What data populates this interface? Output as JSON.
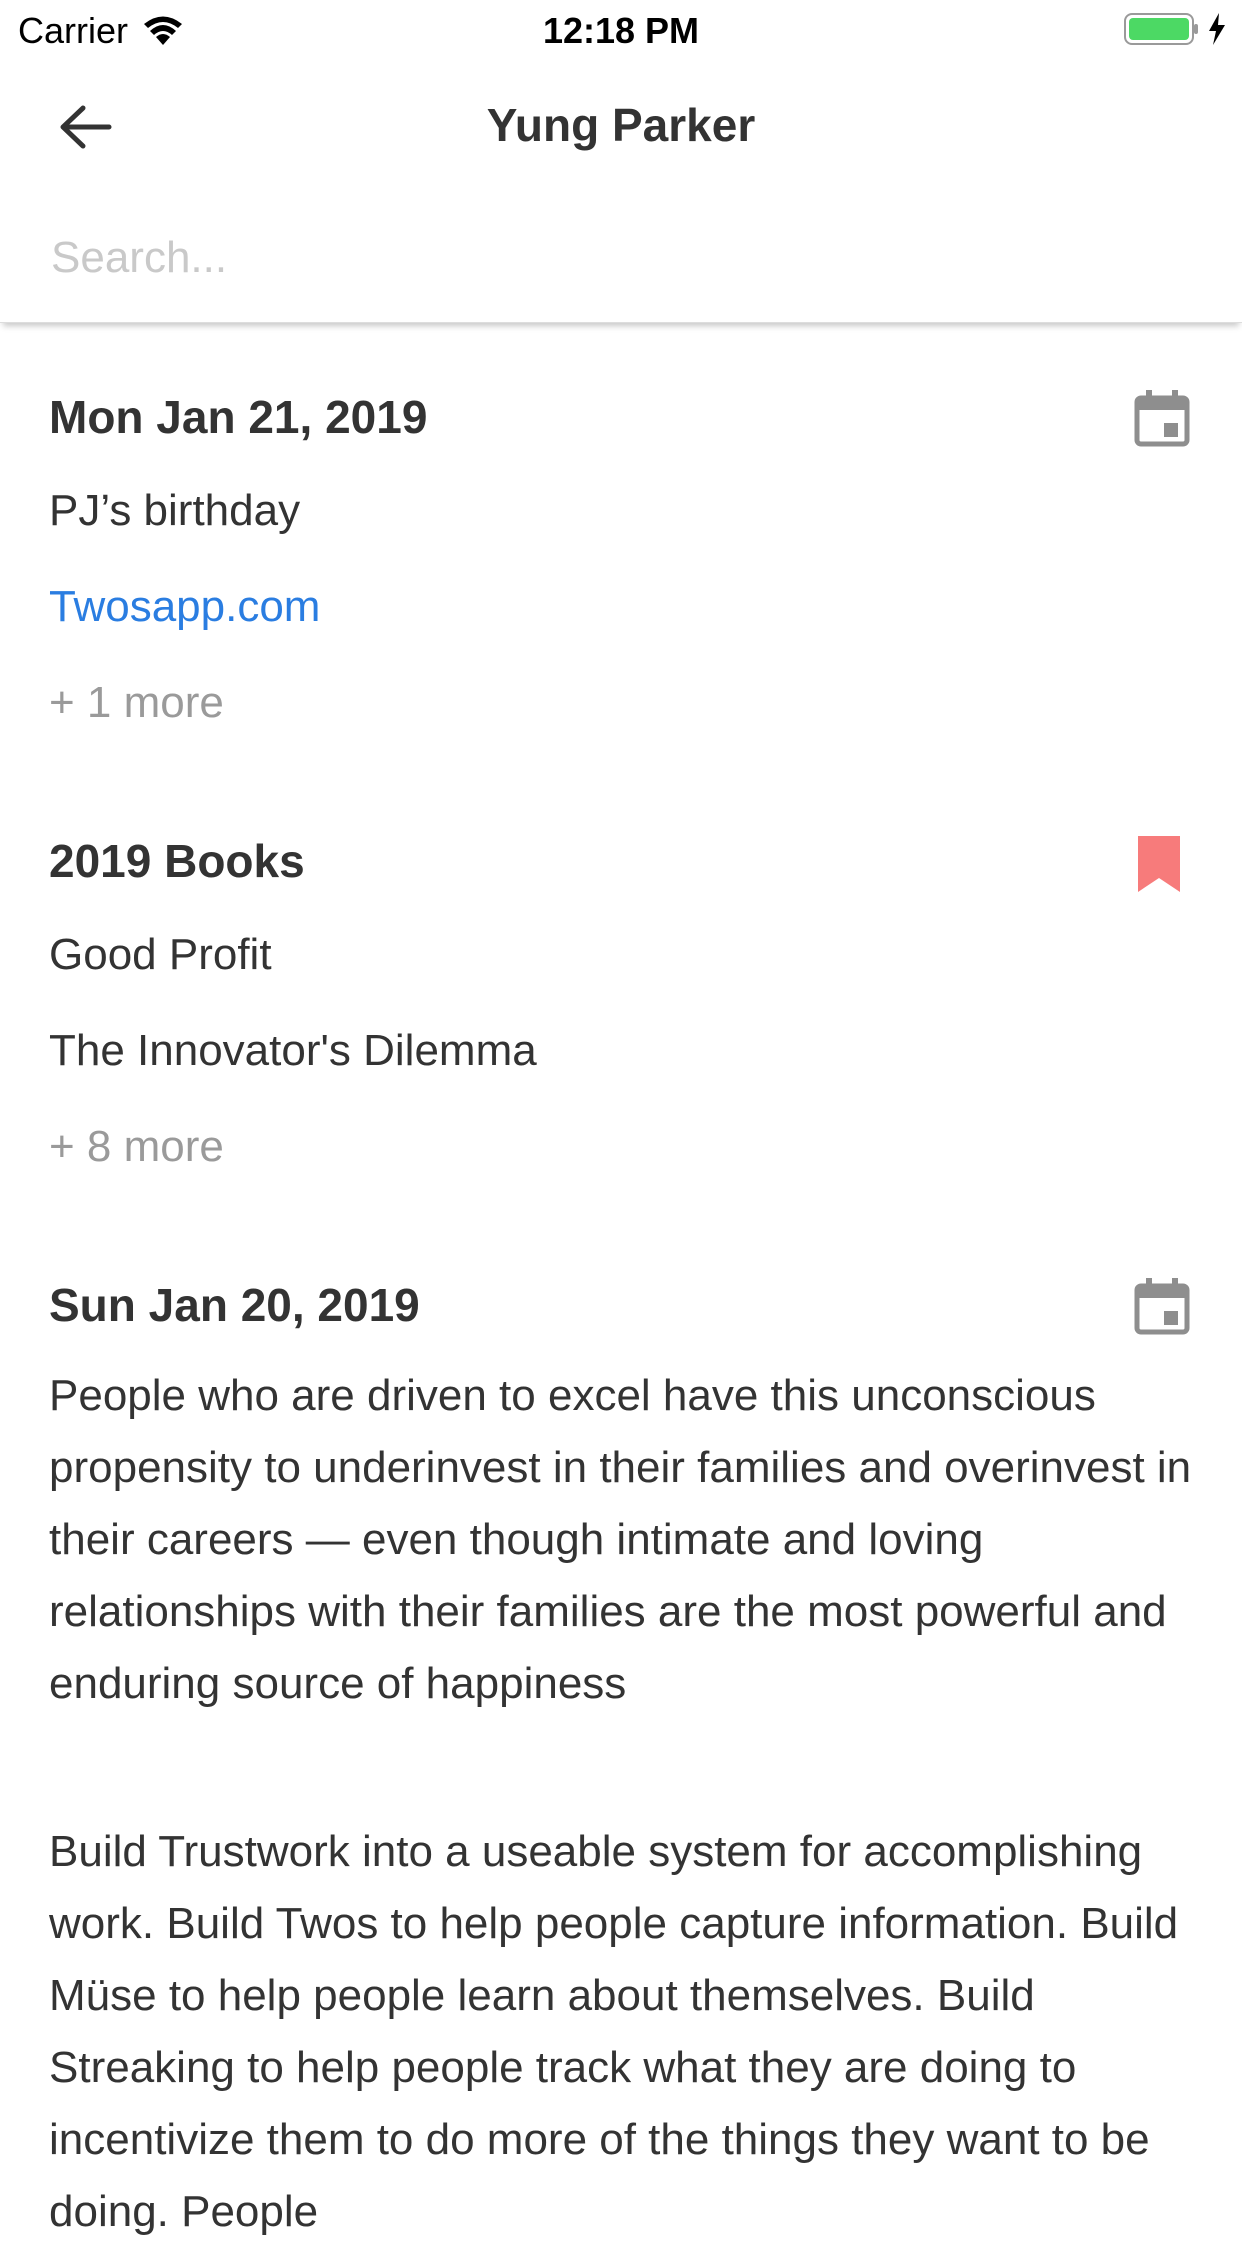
{
  "status": {
    "carrier": "Carrier",
    "time": "12:18 PM"
  },
  "header": {
    "title": "Yung Parker"
  },
  "search": {
    "placeholder": "Search..."
  },
  "cards": [
    {
      "title": "Mon Jan 21, 2019",
      "icon": "calendar-icon",
      "items": [
        "PJ’s birthday",
        "Twosapp.com"
      ],
      "more": "+ 1 more"
    },
    {
      "title": "2019 Books",
      "icon": "bookmark-icon",
      "items": [
        "Good Profit",
        "The Innovator's Dilemma"
      ],
      "more": "+ 8 more"
    },
    {
      "title": "Sun Jan 20, 2019",
      "icon": "calendar-icon",
      "items": [
        "People who are driven to excel have this unconscious propensity to underinvest in their families and overinvest in their careers — even though intimate and loving relationships with their families are the most powerful and enduring source of happiness",
        "Build Trustwork into a useable system for accomplishing work. Build Twos to help people capture information. Build Müse to help people learn about themselves. Build Streaking to help people track what they are doing to incentivize them to do more of the things they want to be doing. People"
      ]
    }
  ],
  "colors": {
    "link": "#2a7de1",
    "bookmark": "#f77b7b",
    "muted": "#9a9a9a",
    "icon": "#8e8e8e"
  }
}
